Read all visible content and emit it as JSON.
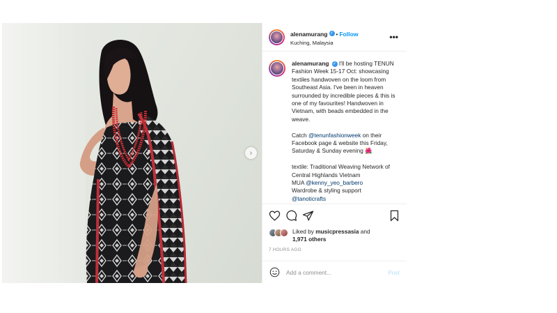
{
  "header": {
    "username": "alenamurang",
    "follow_label": "Follow",
    "location": "Kuching, Malaysia",
    "more_label": "•••"
  },
  "caption": {
    "username": "alenamurang",
    "p1": "I'll be hosting TENUN Fashion Week 15-17 Oct: showcasing textiles handwoven on the loom from Southeast Asia. I've been in heaven surrounded by incredible pieces & this is one of my favourites! Handwoven in Vietnam, with beads embedded in the weave.",
    "p2_a": "Catch ",
    "p2_link": "@tenunfashionweek",
    "p2_b": " on their Facebook page & website this Friday, Saturday & Sunday evening 🌺",
    "p3_line1": "textile: Traditional Weaving Network of Central Highlands Vietnam",
    "p3_mua_prefix": "MUA ",
    "p3_mua_link": "@kenny_yeo_barbero",
    "p3_line3": "Wardrobe & styling support",
    "p3_link4": "@tanoticrafts"
  },
  "likes": {
    "prefix": "Liked by ",
    "user": "musicpressasia",
    "and": " and",
    "others": "1,971 others"
  },
  "timestamp": "7 HOURS AGO",
  "comment": {
    "placeholder": "Add a comment...",
    "post_label": "Post"
  },
  "colors": {
    "accent": "#0095f6",
    "verified": "#3897f0",
    "link": "#00376b"
  }
}
